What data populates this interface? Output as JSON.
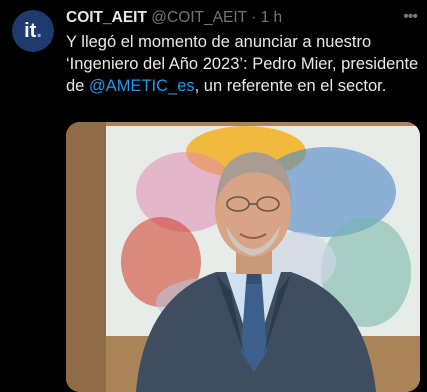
{
  "tweet": {
    "avatar_text": "it",
    "avatar_dot": ".",
    "display_name": "COIT_AEIT",
    "handle": "@COIT_AEIT",
    "separator": "·",
    "time": "1 h",
    "more_label": "•••",
    "text_part1": "Y llegó el momento de anunciar a nuestro ‘Ingeniero del Año 2023’: Pedro Mier, presidente de ",
    "mention": "@AMETIC_es",
    "text_part2": ", un referente en el sector."
  },
  "media": {
    "description": "photo-of-man-in-suit"
  },
  "colors": {
    "background": "#000000",
    "text": "#e7e9ea",
    "secondary": "#71767b",
    "link": "#1d9bf0",
    "avatar_bg": "#1e3a6e"
  }
}
